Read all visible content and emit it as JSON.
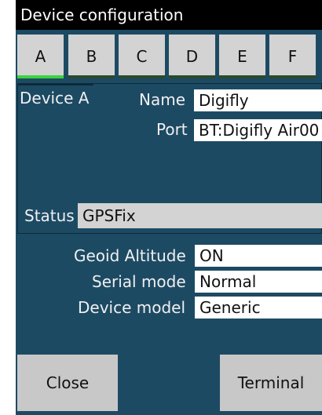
{
  "window": {
    "title": "Device configuration"
  },
  "tabs": [
    {
      "label": "A",
      "active": true
    },
    {
      "label": "B",
      "active": false
    },
    {
      "label": "C",
      "active": false
    },
    {
      "label": "D",
      "active": false
    },
    {
      "label": "E",
      "active": false
    },
    {
      "label": "F",
      "active": false
    }
  ],
  "device": {
    "heading": "Device A",
    "name_label": "Name",
    "name_value": "Digifly",
    "port_label": "Port",
    "port_value": "BT:Digifly Air00",
    "status_label": "Status",
    "status_value": "GPSFix"
  },
  "settings": {
    "geoid_label": "Geoid Altitude",
    "geoid_value": "ON",
    "serial_label": "Serial mode",
    "serial_value": "Normal",
    "model_label": "Device model",
    "model_value": "Generic"
  },
  "buttons": {
    "close": "Close",
    "terminal": "Terminal"
  },
  "colors": {
    "background": "#1d4a63",
    "active_tab_indicator": "#3cd33c"
  }
}
